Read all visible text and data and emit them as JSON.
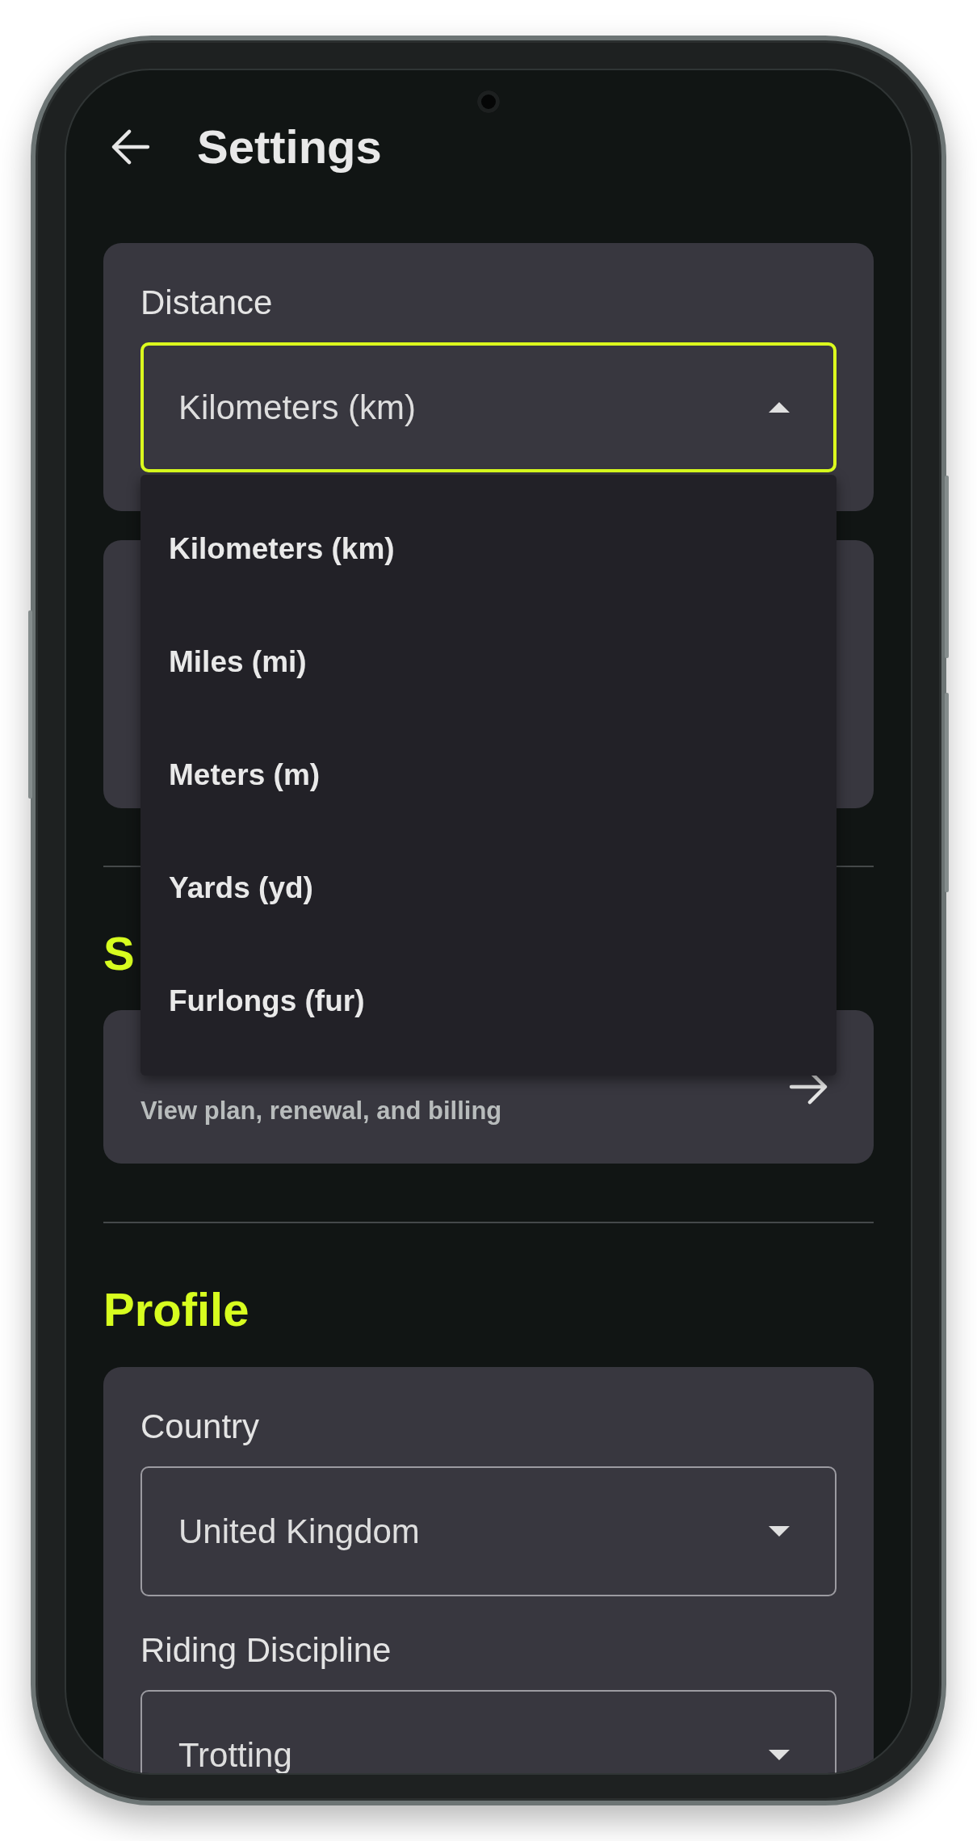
{
  "app_bar": {
    "title": "Settings"
  },
  "units_card": {
    "fields": [
      {
        "label": "Distance",
        "value": "Kilometers (km)",
        "expanded": true,
        "options": [
          "Kilometers (km)",
          "Miles (mi)",
          "Meters (m)",
          "Yards (yd)",
          "Furlongs (fur)"
        ]
      }
    ]
  },
  "subscription_section": {
    "title": "S",
    "items": [
      {
        "subtitle": "View plan, renewal, and billing"
      }
    ]
  },
  "profile_section": {
    "title": "Profile",
    "fields": [
      {
        "label": "Country",
        "value": "United Kingdom",
        "expanded": false
      },
      {
        "label": "Riding Discipline",
        "value": "Trotting",
        "expanded": false
      }
    ]
  }
}
